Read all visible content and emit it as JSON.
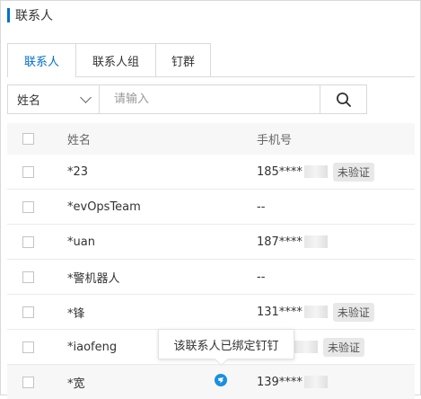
{
  "header": {
    "title": "联系人"
  },
  "tabs": [
    {
      "label": "联系人",
      "active": true
    },
    {
      "label": "联系人组",
      "active": false
    },
    {
      "label": "钉群",
      "active": false
    }
  ],
  "search": {
    "field_selected": "姓名",
    "placeholder": "请输入",
    "search_icon": "search-icon"
  },
  "table": {
    "columns": {
      "name": "姓名",
      "phone": "手机号"
    },
    "rows": [
      {
        "name": "*23",
        "phone": "185****",
        "masked": true,
        "verify": "未验证"
      },
      {
        "name": "*evOpsTeam",
        "phone": "--",
        "masked": false,
        "verify": ""
      },
      {
        "name": "*uan",
        "phone": "187****",
        "masked": true,
        "verify": ""
      },
      {
        "name": "*警机器人",
        "phone": "--",
        "masked": false,
        "verify": ""
      },
      {
        "name": "*锋",
        "phone": "131****",
        "masked": true,
        "verify": "未验证"
      },
      {
        "name": "*iaofeng",
        "phone": "",
        "masked": true,
        "verify": "未验证"
      },
      {
        "name": "*宽",
        "phone": "139****",
        "masked": true,
        "verify": "",
        "dingtalk_bound": true
      }
    ]
  },
  "tooltip": {
    "text": "该联系人已绑定钉钉"
  },
  "colors": {
    "accent": "#0070cc",
    "dingtalk": "#1a8fe0"
  }
}
